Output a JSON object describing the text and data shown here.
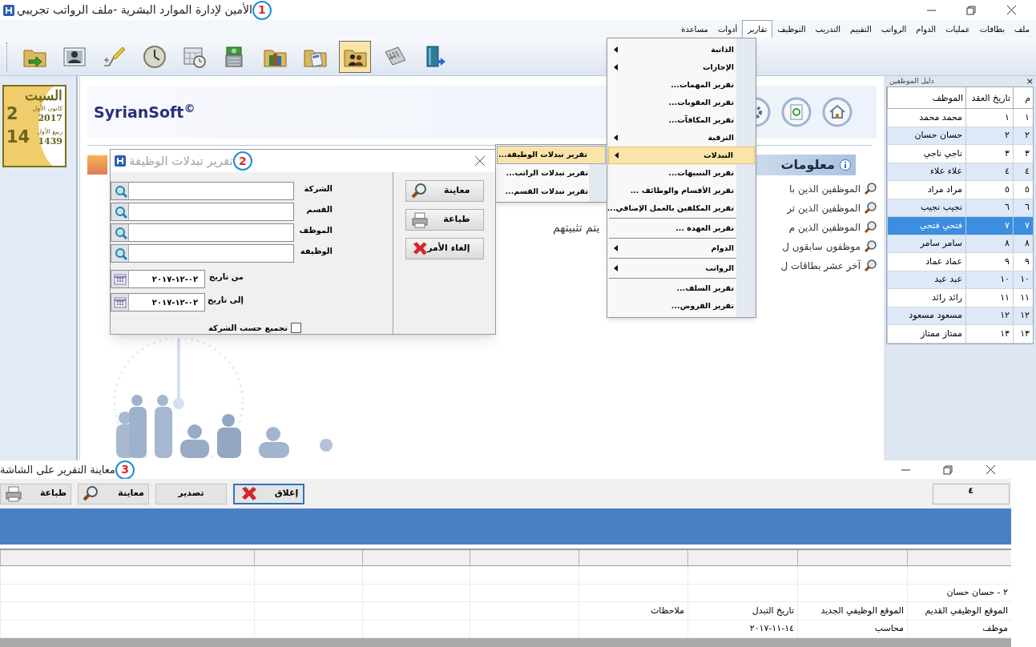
{
  "main_window": {
    "title": "الأمين لإدارة الموارد البشرية -ملف الرواتب تجريبي",
    "callout": "1"
  },
  "menu_bar": [
    {
      "label": "ملف",
      "selected": false
    },
    {
      "label": "بطاقات",
      "selected": false
    },
    {
      "label": "عمليات",
      "selected": false
    },
    {
      "label": "الدوام",
      "selected": false
    },
    {
      "label": "الرواتب",
      "selected": false
    },
    {
      "label": "التقييم",
      "selected": false
    },
    {
      "label": "التدريب",
      "selected": false
    },
    {
      "label": "التوظيف",
      "selected": false
    },
    {
      "label": "تقارير",
      "selected": true
    },
    {
      "label": "أدوات",
      "selected": false
    },
    {
      "label": "مساعدة",
      "selected": false
    }
  ],
  "toolbar": [
    {
      "kind": "folder-arrow",
      "selected": false
    },
    {
      "kind": "person-card",
      "selected": false
    },
    {
      "kind": "pin",
      "selected": false
    },
    {
      "kind": "clock",
      "selected": false
    },
    {
      "kind": "calendar-clock",
      "selected": false
    },
    {
      "kind": "money",
      "selected": false
    },
    {
      "kind": "folder-books",
      "selected": false
    },
    {
      "kind": "folder-docs",
      "selected": false
    },
    {
      "kind": "folder-people",
      "selected": true
    },
    {
      "kind": "calculator",
      "selected": false
    },
    {
      "kind": "book-exit",
      "selected": false
    }
  ],
  "calendar": {
    "weekday": "السبت",
    "month": "كانون الأول",
    "year": "2017",
    "day": "2",
    "hijri_month": "ربيع الأول",
    "hijri_year": "1439",
    "hijri_day": "14"
  },
  "brand": "SyrianSoft$^{©}$",
  "info_panel": {
    "heading": "معلومات",
    "items": [
      {
        "text": "الموظفين الذين با"
      },
      {
        "text": "الموظفين الذين تر"
      },
      {
        "text": "الموظفين الذين م",
        "tail": "يتم تثبيتهم"
      },
      {
        "text": "موظفون سابقون ل"
      },
      {
        "text": "آخر عشر بطاقات ل"
      }
    ]
  },
  "employee_panel": {
    "title": "دليل الموظفين",
    "close": "×",
    "columns": [
      "م",
      "تاريخ العقد",
      "الموظف"
    ],
    "rows": [
      {
        "number": "١",
        "contract": "١",
        "name": "محمد محمد",
        "selected": false
      },
      {
        "number": "٢",
        "contract": "٢",
        "name": "حسان حسان",
        "selected": false
      },
      {
        "number": "٣",
        "contract": "٣",
        "name": "ناجي ناجي",
        "selected": false
      },
      {
        "number": "٤",
        "contract": "٤",
        "name": "علاء علاء",
        "selected": false
      },
      {
        "number": "٥",
        "contract": "٥",
        "name": "مراد مراد",
        "selected": false
      },
      {
        "number": "٦",
        "contract": "٦",
        "name": "نجيب نجيب",
        "selected": false
      },
      {
        "number": "٧",
        "contract": "٧",
        "name": "فتحي فتحي",
        "selected": true
      },
      {
        "number": "٨",
        "contract": "٨",
        "name": "سامر سامر",
        "selected": false
      },
      {
        "number": "٩",
        "contract": "٩",
        "name": "عماد عماد",
        "selected": false
      },
      {
        "number": "١٠",
        "contract": "١٠",
        "name": "عبد عبد",
        "selected": false
      },
      {
        "number": "١١",
        "contract": "١١",
        "name": "رائد رائد",
        "selected": false
      },
      {
        "number": "١٢",
        "contract": "١٢",
        "name": "مسعود مسعود",
        "selected": false
      },
      {
        "number": "١٣",
        "contract": "١٣",
        "name": "ممتاز ممتاز",
        "selected": false
      }
    ]
  },
  "reports_menu": [
    {
      "kind": "submenu",
      "label": "الذاتية",
      "selected": false
    },
    {
      "kind": "submenu",
      "label": "الإجازات",
      "selected": false
    },
    {
      "kind": "item",
      "label": "تقرير المهمات...",
      "selected": false
    },
    {
      "kind": "item",
      "label": "تقرير العقوبات...",
      "selected": false
    },
    {
      "kind": "item",
      "label": "تقرير المكافآت...",
      "selected": false
    },
    {
      "kind": "submenu",
      "label": "الترقية",
      "selected": false
    },
    {
      "kind": "submenu",
      "label": "التبدلات",
      "selected": true
    },
    {
      "kind": "item",
      "label": "تقرير التنبيهات...",
      "selected": false
    },
    {
      "kind": "item",
      "label": "تقرير الأقسام والوظائف ...",
      "selected": false
    },
    {
      "kind": "item",
      "label": "تقرير المكلفين بالعمل الإضافي...",
      "selected": false
    },
    {
      "kind": "separator"
    },
    {
      "kind": "item",
      "label": "تقرير العهدة ...",
      "selected": false
    },
    {
      "kind": "separator"
    },
    {
      "kind": "submenu",
      "label": "الدوام",
      "selected": false
    },
    {
      "kind": "separator"
    },
    {
      "kind": "submenu",
      "label": "الرواتب",
      "selected": false
    },
    {
      "kind": "separator"
    },
    {
      "kind": "item",
      "label": "تقرير السلف...",
      "selected": false
    },
    {
      "kind": "item",
      "label": "تقرير القروض...",
      "selected": false
    }
  ],
  "changes_submenu": [
    {
      "label": "تقرير تبدلات الوظيفة...",
      "selected": true
    },
    {
      "label": "تقرير تبدلات الراتب...",
      "selected": false
    },
    {
      "label": "تقرير تبدلات القسم...",
      "selected": false
    }
  ],
  "dialog": {
    "title": "تقرير تبدلات الوظيفة",
    "callout": "2",
    "lookups": [
      "الشركة",
      "القسم",
      "الموظف",
      "الوظيفة"
    ],
    "dates": [
      {
        "label": "من تاريخ",
        "value": "٠٢-١٢-٢٠١٧"
      },
      {
        "label": "إلى تاريخ",
        "value": "٠٢-١٢-٢٠١٧"
      }
    ],
    "checkbox": {
      "label": "تجميع حسب الشركة",
      "checked": false
    },
    "buttons": [
      {
        "kind": "preview",
        "label": "معاينة"
      },
      {
        "kind": "print",
        "label": "طباعة"
      },
      {
        "kind": "cancel",
        "label": "إلغاء الأمر"
      }
    ]
  },
  "report_window": {
    "title": "معاينة التقرير على الشاشة",
    "callout": "3",
    "page": "٤",
    "buttons": [
      {
        "kind": "close",
        "label": "إغلاق",
        "focused": true
      },
      {
        "kind": "export",
        "label": "تصدير",
        "focused": false
      },
      {
        "kind": "preview",
        "label": "معاينة",
        "focused": false
      },
      {
        "kind": "print",
        "label": "طباعة",
        "focused": false
      }
    ],
    "rows": [
      {
        "kind": "blank"
      },
      {
        "kind": "group",
        "text": "٢ - حسان حسان"
      },
      {
        "kind": "header",
        "cells": [
          "الموقع الوظيفي القديم",
          "الموقع الوظيفي الجديد",
          "تاريخ التبدل",
          "ملاحظات"
        ]
      },
      {
        "kind": "data",
        "cells": [
          "موظف",
          "محاسب",
          "١٤-١١-٢٠١٧"
        ]
      }
    ]
  }
}
